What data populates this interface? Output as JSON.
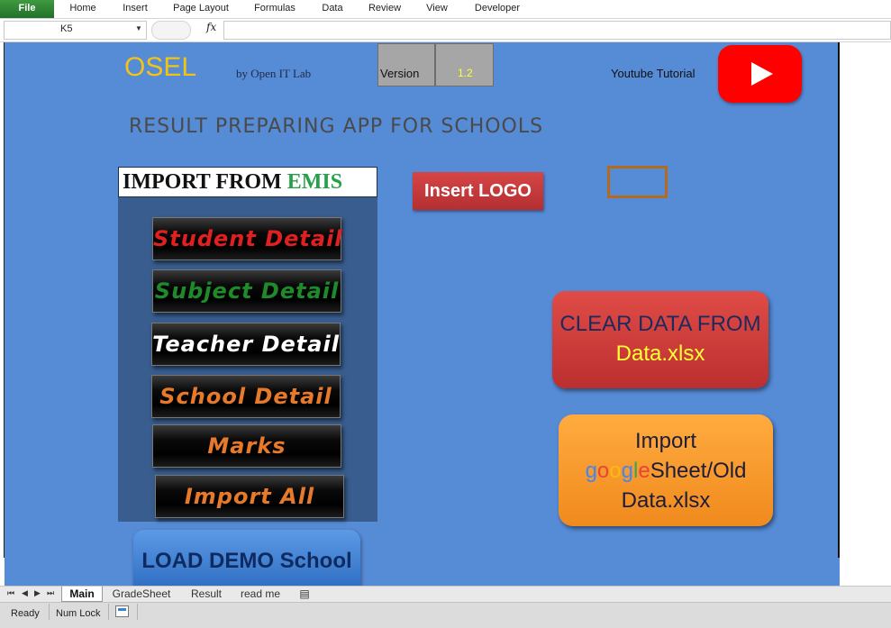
{
  "ribbon": {
    "tabs": [
      "File",
      "Home",
      "Insert",
      "Page Layout",
      "Formulas",
      "Data",
      "Review",
      "View",
      "Developer"
    ]
  },
  "formula_bar": {
    "name_box": "K5",
    "fx_label": "fx",
    "formula": ""
  },
  "header": {
    "app_name": "OSEL",
    "byline": "by Open IT Lab",
    "version_label": "Version",
    "version_number": "1.2",
    "youtube_label": "Youtube Tutorial",
    "youtube_icon": "play-icon"
  },
  "app_title": "RESULT  PREPARING APP FOR SCHOOLS",
  "import_panel": {
    "header_prefix": "IMPORT FROM ",
    "header_emis": "EMIS",
    "buttons": [
      {
        "label": "Student Detail",
        "color": "#e02020"
      },
      {
        "label": "Subject Detail",
        "color": "#1f8a2a"
      },
      {
        "label": "Teacher Detail",
        "color": "#ffffff"
      },
      {
        "label": "School Detail",
        "color": "#e6792a"
      },
      {
        "label": "Marks",
        "color": "#e6792a"
      },
      {
        "label": "Import All",
        "color": "#e6792a"
      }
    ]
  },
  "insert_logo": "Insert LOGO",
  "clear_data": {
    "line1": "CLEAR DATA FROM",
    "line2": "Data.xlsx"
  },
  "import_google": {
    "line1": "Import",
    "google_letters": [
      "g",
      "o",
      "o",
      "g",
      "l",
      "e"
    ],
    "google_colors": [
      "#4285f4",
      "#ea4335",
      "#fbbc05",
      "#4285f4",
      "#34a853",
      "#ea4335"
    ],
    "line2_rest": "Sheet/Old",
    "line3": "Data.xlsx"
  },
  "load_demo": "LOAD DEMO School",
  "sheet_tabs": [
    "Main",
    "GradeSheet",
    "Result",
    "read me"
  ],
  "active_sheet": "Main",
  "status": {
    "ready": "Ready",
    "num_lock": "Num Lock"
  },
  "colors": {
    "canvas": "#568bd6",
    "osel": "#f2c315",
    "youtube": "#ff0000",
    "excel_green": "#2f7d32"
  }
}
